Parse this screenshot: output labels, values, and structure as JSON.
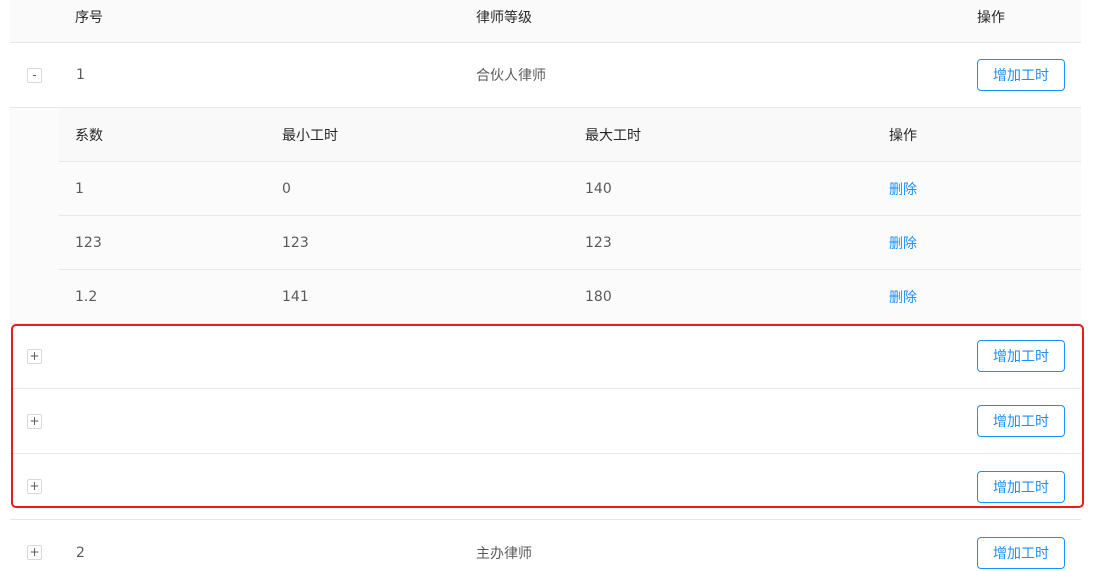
{
  "table": {
    "headers": {
      "index": "序号",
      "level": "律师等级",
      "action": "操作"
    },
    "rows": [
      {
        "expand_symbol": "-",
        "index": "1",
        "level": "合伙人律师",
        "add_label": "增加工时"
      },
      {
        "expand_symbol": "+",
        "index": "",
        "level": "",
        "add_label": "增加工时"
      },
      {
        "expand_symbol": "+",
        "index": "",
        "level": "",
        "add_label": "增加工时"
      },
      {
        "expand_symbol": "+",
        "index": "",
        "level": "",
        "add_label": "增加工时"
      },
      {
        "expand_symbol": "+",
        "index": "2",
        "level": "主办律师",
        "add_label": "增加工时"
      }
    ]
  },
  "sub_table": {
    "headers": {
      "coefficient": "系数",
      "min_hours": "最小工时",
      "max_hours": "最大工时",
      "action": "操作"
    },
    "rows": [
      {
        "coefficient": "1",
        "min_hours": "0",
        "max_hours": "140",
        "delete_label": "删除"
      },
      {
        "coefficient": "123",
        "min_hours": "123",
        "max_hours": "123",
        "delete_label": "删除"
      },
      {
        "coefficient": "1.2",
        "min_hours": "141",
        "max_hours": "180",
        "delete_label": "删除"
      }
    ]
  },
  "colors": {
    "link": "#1890ff",
    "highlight": "#e81c1c",
    "border": "#e8e8e8"
  }
}
